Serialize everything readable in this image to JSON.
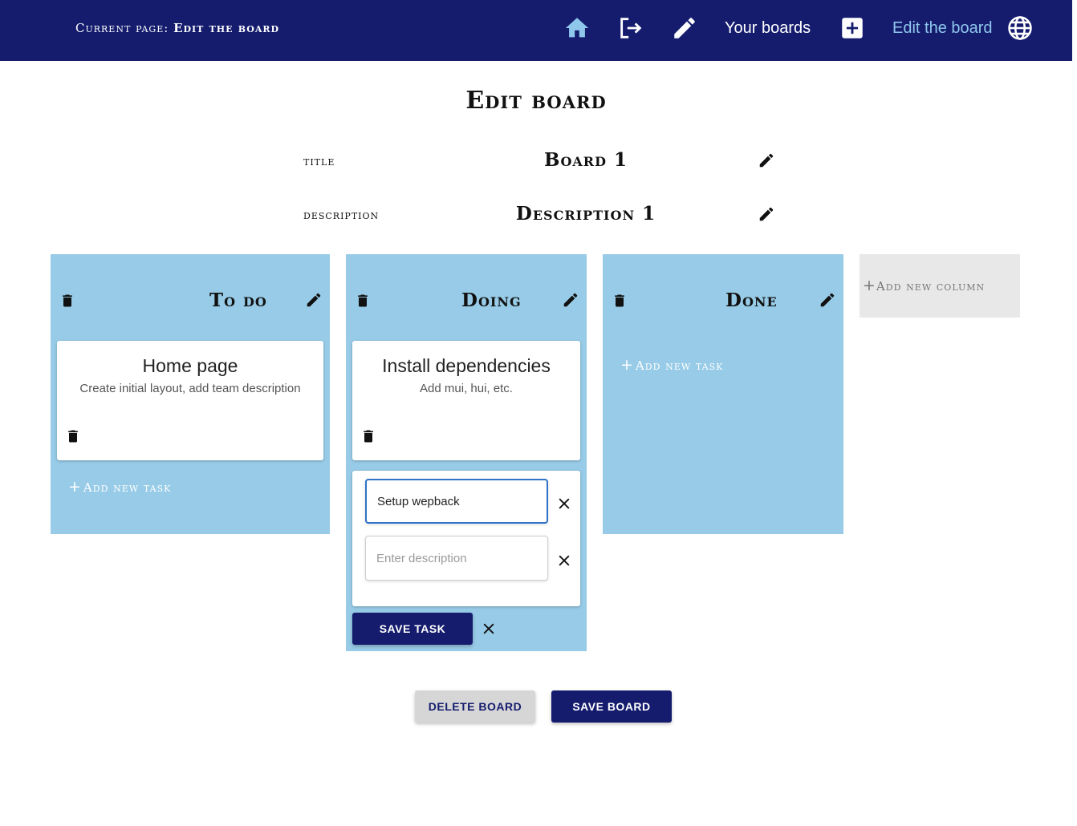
{
  "header": {
    "current_prefix": "Current page:",
    "current_page": "Edit the board",
    "nav_your_boards": "Your boards",
    "nav_edit_board": "Edit the board",
    "icons": [
      "home-icon",
      "logout-icon",
      "pencil-icon",
      "add-box-icon",
      "globe-icon"
    ],
    "colors": {
      "bar": "#151c6e",
      "active_link": "#8fc7ec"
    }
  },
  "page": {
    "title": "Edit board",
    "title_label": "title",
    "title_value": "Board 1",
    "description_label": "description",
    "description_value": "Description 1"
  },
  "columns": [
    {
      "title": "To do",
      "tasks": [
        {
          "title": "Home page",
          "description": "Create initial layout, add team description"
        }
      ],
      "add_task": "Add new task"
    },
    {
      "title": "Doing",
      "tasks": [
        {
          "title": "Install dependencies",
          "description": "Add mui, hui, etc."
        }
      ],
      "new_task_form": {
        "title_value": "Setup wepback",
        "description_placeholder": "Enter description",
        "save_label": "SAVE TASK"
      }
    },
    {
      "title": "Done",
      "tasks": [],
      "add_task": "Add new task"
    }
  ],
  "add_column": "Add new column",
  "actions": {
    "delete_board": "DELETE BOARD",
    "save_board": "SAVE BOARD"
  },
  "colors": {
    "column_bg": "#97cbe7",
    "primary": "#151c6e",
    "secondary": "#d6d6d6"
  }
}
